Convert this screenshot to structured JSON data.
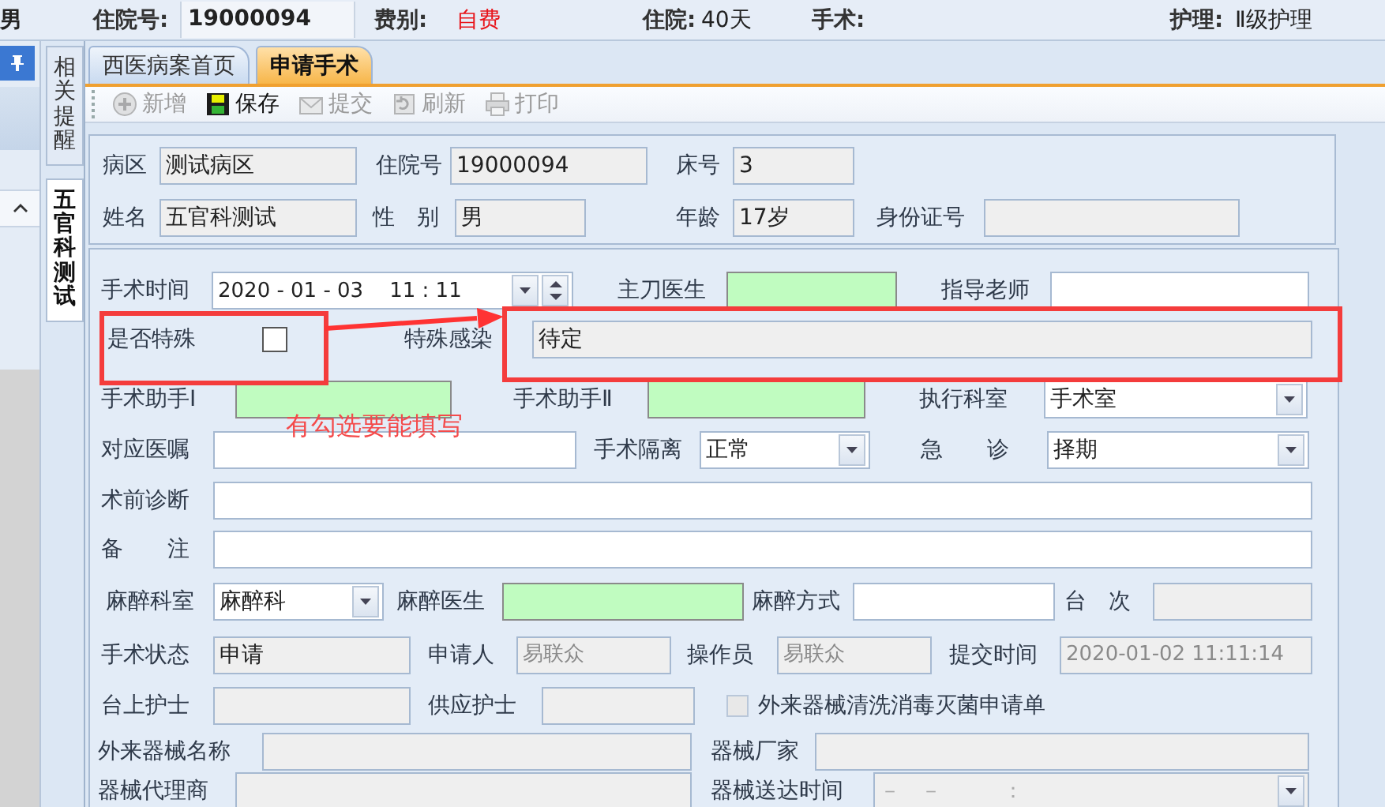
{
  "header": [
    {
      "kind": "text",
      "text": "男"
    },
    {
      "kind": "label",
      "text": "住院号:"
    },
    {
      "kind": "field",
      "text": "19000094"
    },
    {
      "kind": "label",
      "text": "费别:"
    },
    {
      "kind": "alert",
      "text": "自费"
    },
    {
      "kind": "label",
      "text": "住院:"
    },
    {
      "kind": "text",
      "text": "40天"
    },
    {
      "kind": "label",
      "text": "手术:"
    },
    {
      "kind": "label",
      "text": "护理:"
    },
    {
      "kind": "text",
      "text": "Ⅱ级护理"
    }
  ],
  "side_tabs": [
    {
      "label": "相关提醒",
      "selected": false
    },
    {
      "label": "五官科测试",
      "selected": true
    }
  ],
  "tabs": [
    {
      "label": "西医病案首页",
      "selected": false
    },
    {
      "label": "申请手术",
      "selected": true
    }
  ],
  "toolbar": [
    {
      "kind": "add",
      "label": "新增",
      "disabled": true
    },
    {
      "kind": "save",
      "label": "保存",
      "disabled": false
    },
    {
      "kind": "submit",
      "label": "提交",
      "disabled": true
    },
    {
      "kind": "refresh",
      "label": "刷新",
      "disabled": true
    },
    {
      "kind": "print",
      "label": "打印",
      "disabled": true
    }
  ],
  "patient": [
    [
      {
        "kind": "label",
        "text": "病区"
      },
      {
        "kind": "field",
        "readonly": true,
        "required": false,
        "value": "测试病区",
        "greyed": false
      },
      {
        "kind": "label",
        "text": "住院号"
      },
      {
        "kind": "field",
        "readonly": true,
        "required": false,
        "value": "19000094",
        "greyed": false
      },
      {
        "kind": "label",
        "text": "床号"
      },
      {
        "kind": "field",
        "readonly": true,
        "required": false,
        "value": "3",
        "greyed": false
      }
    ],
    [
      {
        "kind": "label",
        "text": "姓名"
      },
      {
        "kind": "field",
        "readonly": true,
        "required": false,
        "value": "五官科测试",
        "greyed": false
      },
      {
        "kind": "label",
        "text": "性　别"
      },
      {
        "kind": "field",
        "readonly": true,
        "required": false,
        "value": "男",
        "greyed": false
      },
      {
        "kind": "label",
        "text": "年龄"
      },
      {
        "kind": "field",
        "readonly": true,
        "required": false,
        "value": "17岁",
        "greyed": false
      },
      {
        "kind": "label",
        "text": "身份证号"
      },
      {
        "kind": "field",
        "readonly": true,
        "required": false
      }
    ]
  ],
  "form": [
    [
      {
        "kind": "label",
        "text": "手术时间"
      },
      {
        "kind": "date",
        "value": "2020 - 01 - 03    11 : 11",
        "disabled": false,
        "spin": true
      },
      {
        "kind": "label",
        "text": "主刀医生"
      },
      {
        "kind": "field",
        "required": true
      },
      {
        "kind": "label",
        "text": "指导老师"
      },
      {
        "kind": "field",
        "readonly": false,
        "required": false
      }
    ],
    [
      {
        "kind": "label",
        "text": "是否特殊"
      },
      {
        "kind": "checkbox",
        "checked": false,
        "disabled": false
      },
      {
        "kind": "label",
        "text": "特殊感染"
      },
      {
        "kind": "field",
        "readonly": true,
        "required": false,
        "value": "待定",
        "greyed": false
      }
    ],
    [
      {
        "kind": "label",
        "text": "手术助手Ⅰ"
      },
      {
        "kind": "field",
        "required": true
      },
      {
        "kind": "label",
        "text": "手术助手Ⅱ"
      },
      {
        "kind": "field",
        "required": true
      },
      {
        "kind": "label",
        "text": "执行科室"
      },
      {
        "kind": "combo",
        "value": "手术室"
      }
    ],
    [
      {
        "kind": "label",
        "text": "对应医嘱"
      },
      {
        "kind": "field",
        "readonly": false,
        "required": false
      },
      {
        "kind": "label",
        "text": "手术隔离"
      },
      {
        "kind": "combo",
        "value": "正常"
      },
      {
        "kind": "label",
        "text": "急　　诊"
      },
      {
        "kind": "combo",
        "value": "择期"
      }
    ],
    [
      {
        "kind": "label",
        "text": "术前诊断"
      },
      {
        "kind": "field",
        "readonly": false,
        "required": false
      }
    ],
    [
      {
        "kind": "label",
        "text": "备　　注"
      },
      {
        "kind": "field",
        "readonly": false,
        "required": false
      }
    ],
    [
      {
        "kind": "label",
        "text": "麻醉科室"
      },
      {
        "kind": "combo",
        "value": "麻醉科"
      },
      {
        "kind": "label",
        "text": "麻醉医生"
      },
      {
        "kind": "field",
        "required": true
      },
      {
        "kind": "label",
        "text": "麻醉方式"
      },
      {
        "kind": "field",
        "readonly": false,
        "required": false
      },
      {
        "kind": "label",
        "text": "台　次"
      },
      {
        "kind": "field",
        "readonly": true,
        "required": false
      }
    ],
    [
      {
        "kind": "label",
        "text": "手术状态"
      },
      {
        "kind": "field",
        "readonly": true,
        "required": false,
        "value": "申请",
        "greyed": false
      },
      {
        "kind": "label",
        "text": "申请人"
      },
      {
        "kind": "field",
        "readonly": true,
        "required": false,
        "value": "易联众",
        "greyed": true
      },
      {
        "kind": "label",
        "text": "操作员"
      },
      {
        "kind": "field",
        "readonly": true,
        "required": false,
        "value": "易联众",
        "greyed": true
      },
      {
        "kind": "label",
        "text": "提交时间"
      },
      {
        "kind": "field",
        "readonly": true,
        "required": false,
        "value": "2020-01-02 11:11:14",
        "greyed": true
      }
    ],
    [
      {
        "kind": "label",
        "text": "台上护士"
      },
      {
        "kind": "field",
        "readonly": true,
        "required": false
      },
      {
        "kind": "label",
        "text": "供应护士"
      },
      {
        "kind": "field",
        "readonly": true,
        "required": false
      },
      {
        "kind": "checkbox",
        "checked": false,
        "disabled": true,
        "label": "外来器械清洗消毒灭菌申请单"
      }
    ],
    [
      {
        "kind": "label",
        "text": "外来器械名称"
      },
      {
        "kind": "field",
        "readonly": true,
        "required": false
      },
      {
        "kind": "label",
        "text": "器械厂家"
      },
      {
        "kind": "field",
        "readonly": true,
        "required": false
      }
    ],
    [
      {
        "kind": "label",
        "text": "器械代理商"
      },
      {
        "kind": "field",
        "readonly": true,
        "required": false
      },
      {
        "kind": "label",
        "text": "器械送达时间"
      },
      {
        "kind": "date",
        "value": "－　－　　　：",
        "disabled": true,
        "spin": false
      }
    ]
  ],
  "annotation": {
    "note": "有勾选要能填写"
  }
}
